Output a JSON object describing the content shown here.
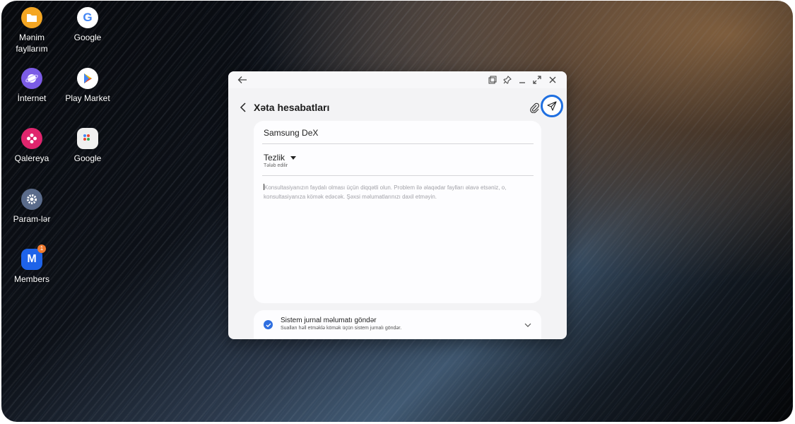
{
  "desktop": {
    "icons": [
      {
        "label": "Mənim\nfayllarım",
        "icon": "folder-icon",
        "color": "#f4a623"
      },
      {
        "label": "Google",
        "icon": "google-icon",
        "color": "#ffffff"
      },
      {
        "label": "İnternet",
        "icon": "internet-icon",
        "color": "#7b5ce6"
      },
      {
        "label": "Play Market",
        "icon": "play-market-icon",
        "color": "#ffffff"
      },
      {
        "label": "Qalereya",
        "icon": "gallery-icon",
        "color": "#e0256d"
      },
      {
        "label": "Google",
        "icon": "google-folder-icon",
        "color": "#f0f0f0"
      },
      {
        "label": "Param-lər",
        "icon": "settings-icon",
        "color": "#5a6b8a"
      },
      {
        "label": "Members",
        "icon": "members-icon",
        "color": "#1e63e9",
        "badge": "1"
      }
    ]
  },
  "window": {
    "title": "Xəta hesabatları",
    "app_name": "Samsung DeX",
    "category": {
      "label": "Tezlik",
      "hint": "Tələb edilir"
    },
    "description_placeholder": "Konsultasiyanızın faydalı olması üçün diqqətli olun. Problem ilə əlaqədar faylları əlavə etsəniz, o, konsultasiyanıza kömək edəcək. Şəxsi məlumatlarınızı daxil etməyin.",
    "system_log": {
      "title": "Sistem jurnal məlumatı göndər",
      "subtitle": "Sualları həll etməklə kömək üçün sistem jurnalı göndər.",
      "checked": true
    }
  },
  "colors": {
    "accent": "#1f6fe0",
    "badge": "#f07a2e"
  }
}
